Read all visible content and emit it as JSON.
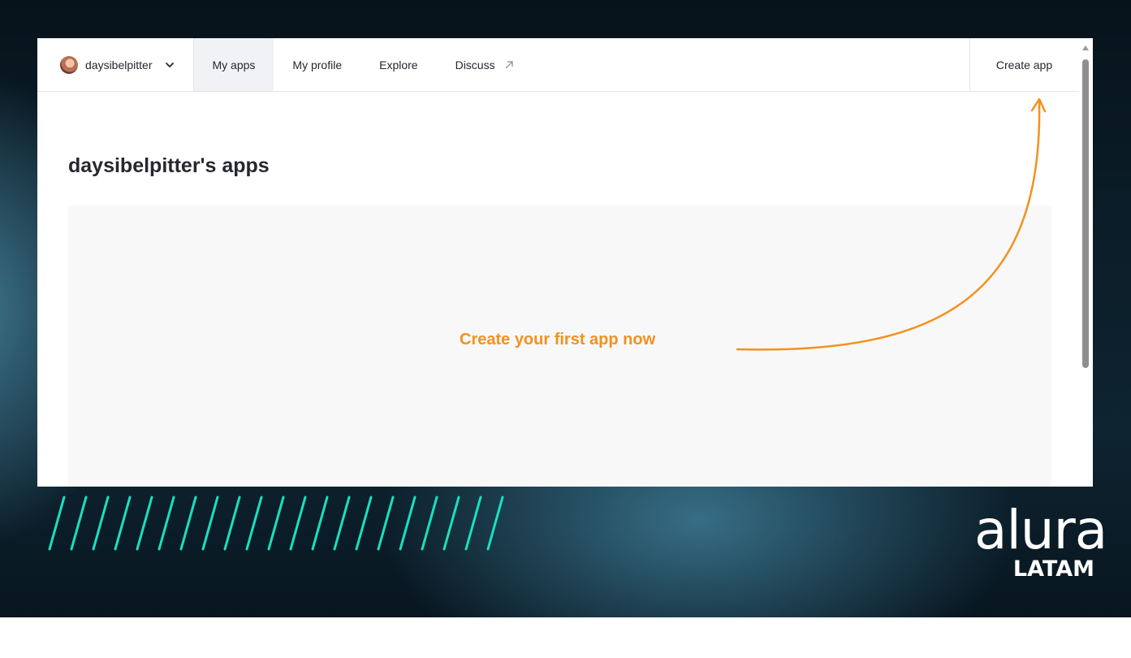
{
  "nav": {
    "username": "daysibelpitter",
    "tabs": [
      {
        "label": "My apps",
        "active": true
      },
      {
        "label": "My profile",
        "active": false
      },
      {
        "label": "Explore",
        "active": false
      },
      {
        "label": "Discuss",
        "active": false,
        "external": true
      }
    ],
    "create_button": "Create app"
  },
  "main": {
    "title": "daysibelpitter's apps",
    "cta": "Create your first app now"
  },
  "brand": {
    "logo": "alura",
    "tagline": "LATAM"
  },
  "colors": {
    "accent_orange": "#f5901e",
    "stripe_teal": "#19e0c0",
    "active_tab_bg": "#f0f2f6"
  }
}
